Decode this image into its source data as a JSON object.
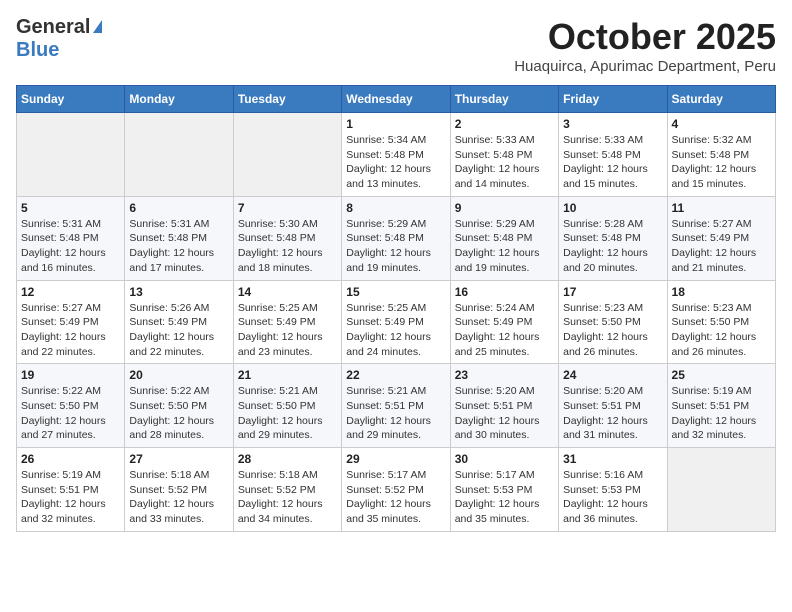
{
  "header": {
    "logo_general": "General",
    "logo_blue": "Blue",
    "month_year": "October 2025",
    "location": "Huaquirca, Apurimac Department, Peru"
  },
  "weekdays": [
    "Sunday",
    "Monday",
    "Tuesday",
    "Wednesday",
    "Thursday",
    "Friday",
    "Saturday"
  ],
  "weeks": [
    [
      {
        "day": "",
        "info": ""
      },
      {
        "day": "",
        "info": ""
      },
      {
        "day": "",
        "info": ""
      },
      {
        "day": "1",
        "info": "Sunrise: 5:34 AM\nSunset: 5:48 PM\nDaylight: 12 hours\nand 13 minutes."
      },
      {
        "day": "2",
        "info": "Sunrise: 5:33 AM\nSunset: 5:48 PM\nDaylight: 12 hours\nand 14 minutes."
      },
      {
        "day": "3",
        "info": "Sunrise: 5:33 AM\nSunset: 5:48 PM\nDaylight: 12 hours\nand 15 minutes."
      },
      {
        "day": "4",
        "info": "Sunrise: 5:32 AM\nSunset: 5:48 PM\nDaylight: 12 hours\nand 15 minutes."
      }
    ],
    [
      {
        "day": "5",
        "info": "Sunrise: 5:31 AM\nSunset: 5:48 PM\nDaylight: 12 hours\nand 16 minutes."
      },
      {
        "day": "6",
        "info": "Sunrise: 5:31 AM\nSunset: 5:48 PM\nDaylight: 12 hours\nand 17 minutes."
      },
      {
        "day": "7",
        "info": "Sunrise: 5:30 AM\nSunset: 5:48 PM\nDaylight: 12 hours\nand 18 minutes."
      },
      {
        "day": "8",
        "info": "Sunrise: 5:29 AM\nSunset: 5:48 PM\nDaylight: 12 hours\nand 19 minutes."
      },
      {
        "day": "9",
        "info": "Sunrise: 5:29 AM\nSunset: 5:48 PM\nDaylight: 12 hours\nand 19 minutes."
      },
      {
        "day": "10",
        "info": "Sunrise: 5:28 AM\nSunset: 5:48 PM\nDaylight: 12 hours\nand 20 minutes."
      },
      {
        "day": "11",
        "info": "Sunrise: 5:27 AM\nSunset: 5:49 PM\nDaylight: 12 hours\nand 21 minutes."
      }
    ],
    [
      {
        "day": "12",
        "info": "Sunrise: 5:27 AM\nSunset: 5:49 PM\nDaylight: 12 hours\nand 22 minutes."
      },
      {
        "day": "13",
        "info": "Sunrise: 5:26 AM\nSunset: 5:49 PM\nDaylight: 12 hours\nand 22 minutes."
      },
      {
        "day": "14",
        "info": "Sunrise: 5:25 AM\nSunset: 5:49 PM\nDaylight: 12 hours\nand 23 minutes."
      },
      {
        "day": "15",
        "info": "Sunrise: 5:25 AM\nSunset: 5:49 PM\nDaylight: 12 hours\nand 24 minutes."
      },
      {
        "day": "16",
        "info": "Sunrise: 5:24 AM\nSunset: 5:49 PM\nDaylight: 12 hours\nand 25 minutes."
      },
      {
        "day": "17",
        "info": "Sunrise: 5:23 AM\nSunset: 5:50 PM\nDaylight: 12 hours\nand 26 minutes."
      },
      {
        "day": "18",
        "info": "Sunrise: 5:23 AM\nSunset: 5:50 PM\nDaylight: 12 hours\nand 26 minutes."
      }
    ],
    [
      {
        "day": "19",
        "info": "Sunrise: 5:22 AM\nSunset: 5:50 PM\nDaylight: 12 hours\nand 27 minutes."
      },
      {
        "day": "20",
        "info": "Sunrise: 5:22 AM\nSunset: 5:50 PM\nDaylight: 12 hours\nand 28 minutes."
      },
      {
        "day": "21",
        "info": "Sunrise: 5:21 AM\nSunset: 5:50 PM\nDaylight: 12 hours\nand 29 minutes."
      },
      {
        "day": "22",
        "info": "Sunrise: 5:21 AM\nSunset: 5:51 PM\nDaylight: 12 hours\nand 29 minutes."
      },
      {
        "day": "23",
        "info": "Sunrise: 5:20 AM\nSunset: 5:51 PM\nDaylight: 12 hours\nand 30 minutes."
      },
      {
        "day": "24",
        "info": "Sunrise: 5:20 AM\nSunset: 5:51 PM\nDaylight: 12 hours\nand 31 minutes."
      },
      {
        "day": "25",
        "info": "Sunrise: 5:19 AM\nSunset: 5:51 PM\nDaylight: 12 hours\nand 32 minutes."
      }
    ],
    [
      {
        "day": "26",
        "info": "Sunrise: 5:19 AM\nSunset: 5:51 PM\nDaylight: 12 hours\nand 32 minutes."
      },
      {
        "day": "27",
        "info": "Sunrise: 5:18 AM\nSunset: 5:52 PM\nDaylight: 12 hours\nand 33 minutes."
      },
      {
        "day": "28",
        "info": "Sunrise: 5:18 AM\nSunset: 5:52 PM\nDaylight: 12 hours\nand 34 minutes."
      },
      {
        "day": "29",
        "info": "Sunrise: 5:17 AM\nSunset: 5:52 PM\nDaylight: 12 hours\nand 35 minutes."
      },
      {
        "day": "30",
        "info": "Sunrise: 5:17 AM\nSunset: 5:53 PM\nDaylight: 12 hours\nand 35 minutes."
      },
      {
        "day": "31",
        "info": "Sunrise: 5:16 AM\nSunset: 5:53 PM\nDaylight: 12 hours\nand 36 minutes."
      },
      {
        "day": "",
        "info": ""
      }
    ]
  ]
}
